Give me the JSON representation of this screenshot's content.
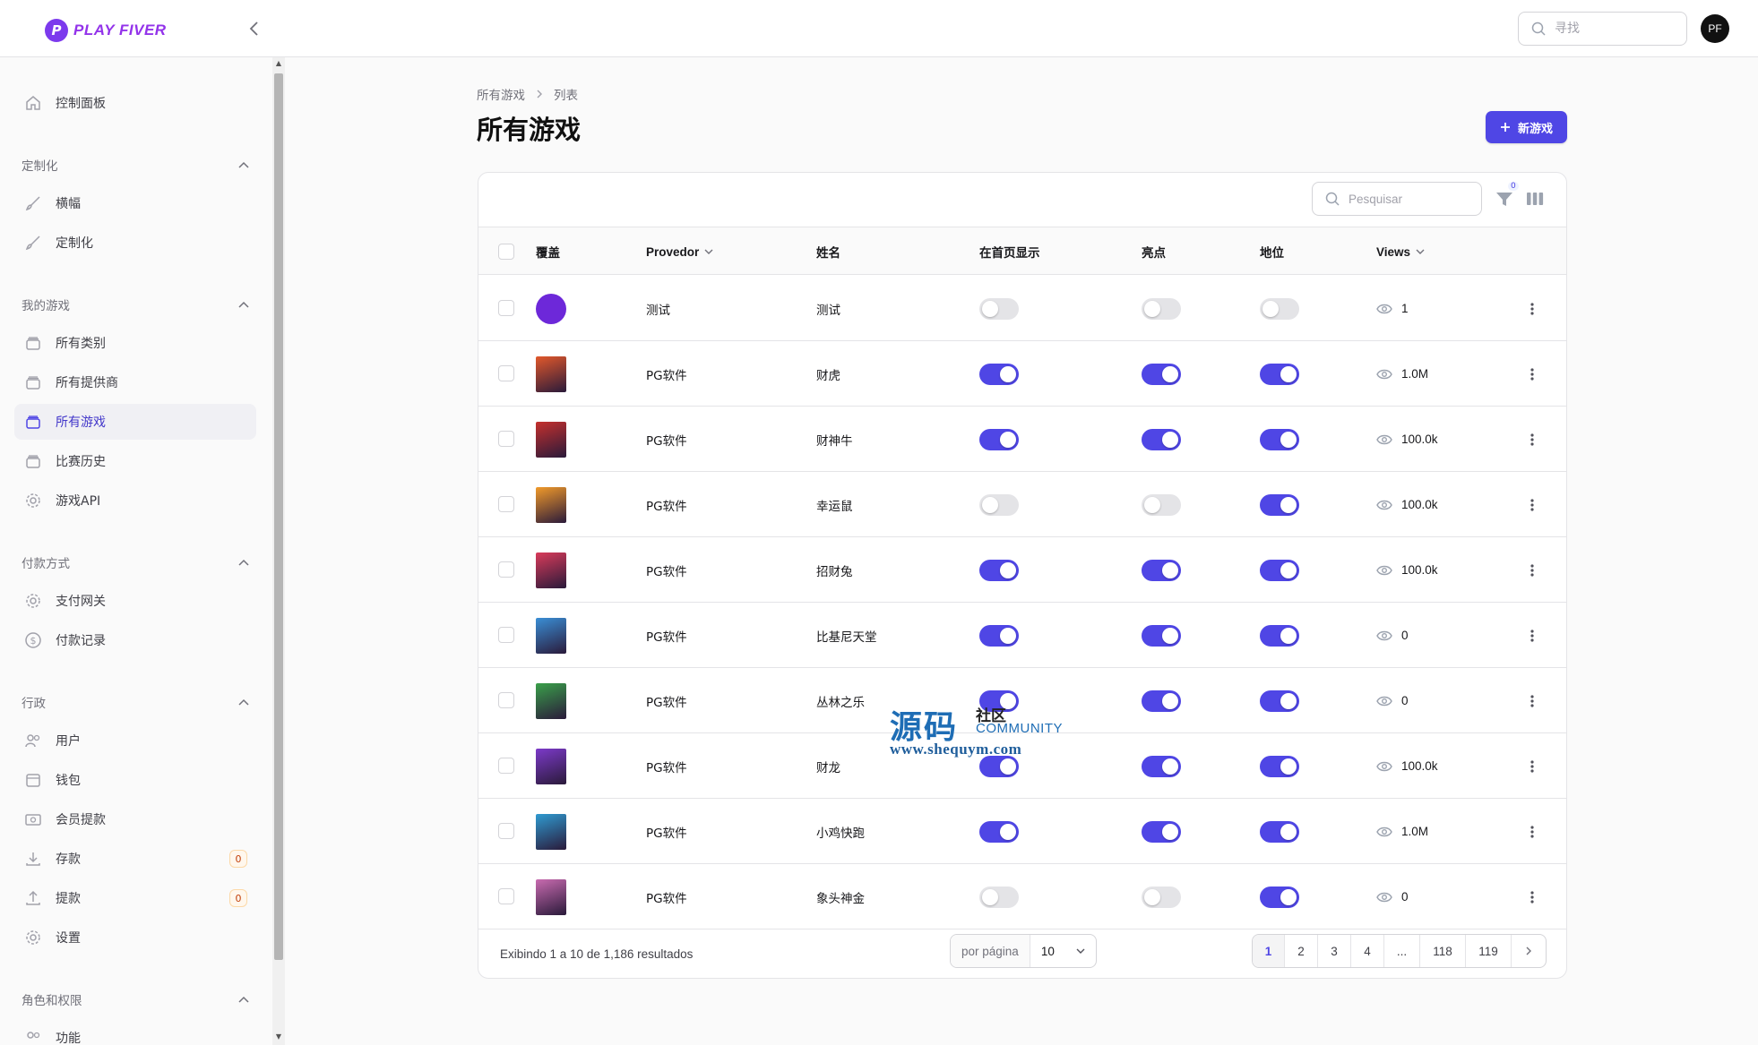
{
  "brand": {
    "name": "PLAY FIVER",
    "mark": "P"
  },
  "header": {
    "search_placeholder": "寻找",
    "avatar_initials": "PF"
  },
  "sidebar": {
    "dashboard": "控制面板",
    "groups": [
      {
        "title": "定制化",
        "items": [
          "横幅",
          "定制化"
        ]
      },
      {
        "title": "我的游戏",
        "items": [
          "所有类别",
          "所有提供商",
          "所有游戏",
          "比赛历史",
          "游戏API"
        ]
      },
      {
        "title": "付款方式",
        "items": [
          "支付网关",
          "付款记录"
        ]
      },
      {
        "title": "行政",
        "items": [
          "用户",
          "钱包",
          "会员提款",
          "存款",
          "提款",
          "设置"
        ]
      },
      {
        "title": "角色和权限",
        "items": [
          "功能"
        ]
      }
    ],
    "active_item": "所有游戏",
    "deposit_badge": "0",
    "withdraw_badge": "0"
  },
  "breadcrumb": [
    "所有游戏",
    "列表"
  ],
  "page_title": "所有游戏",
  "new_button": "新游戏",
  "table": {
    "search_placeholder": "Pesquisar",
    "filter_count": "0",
    "columns": [
      "覆盖",
      "Provedor",
      "姓名",
      "在首页显示",
      "亮点",
      "地位",
      "Views"
    ],
    "rows": [
      {
        "provider": "测试",
        "name": "测试",
        "home": false,
        "highlight": false,
        "status": false,
        "views": "1",
        "cover_color": "#6d28d9"
      },
      {
        "provider": "PG软件",
        "name": "财虎",
        "home": true,
        "highlight": true,
        "status": true,
        "views": "1.0M",
        "cover_color": "#e2582b"
      },
      {
        "provider": "PG软件",
        "name": "财神牛",
        "home": true,
        "highlight": true,
        "status": true,
        "views": "100.0k",
        "cover_color": "#c5302d"
      },
      {
        "provider": "PG软件",
        "name": "幸运鼠",
        "home": false,
        "highlight": false,
        "status": true,
        "views": "100.0k",
        "cover_color": "#f19a2a"
      },
      {
        "provider": "PG软件",
        "name": "招财兔",
        "home": true,
        "highlight": true,
        "status": true,
        "views": "100.0k",
        "cover_color": "#d93b5a"
      },
      {
        "provider": "PG软件",
        "name": "比基尼天堂",
        "home": true,
        "highlight": true,
        "status": true,
        "views": "0",
        "cover_color": "#3a8fd6"
      },
      {
        "provider": "PG软件",
        "name": "丛林之乐",
        "home": true,
        "highlight": true,
        "status": true,
        "views": "0",
        "cover_color": "#3aa04a"
      },
      {
        "provider": "PG软件",
        "name": "财龙",
        "home": true,
        "highlight": true,
        "status": true,
        "views": "100.0k",
        "cover_color": "#7c3ac9"
      },
      {
        "provider": "PG软件",
        "name": "小鸡快跑",
        "home": true,
        "highlight": true,
        "status": true,
        "views": "1.0M",
        "cover_color": "#2f9bd1"
      },
      {
        "provider": "PG软件",
        "name": "象头神金",
        "home": false,
        "highlight": false,
        "status": true,
        "views": "0",
        "cover_color": "#c96bb0"
      }
    ],
    "summary": "Exibindo 1 a 10 de 1,186 resultados",
    "per_page_label": "por página",
    "per_page_value": "10",
    "pages": [
      "1",
      "2",
      "3",
      "4",
      "...",
      "118",
      "119"
    ],
    "current_page": "1"
  },
  "watermark": {
    "main": "源码",
    "side": "社区",
    "community": "COMMUNITY",
    "url": "www.shequym.com"
  },
  "colors": {
    "accent": "#4f46e5",
    "toggle_off": "#e4e4e7",
    "brand": "#9333ea"
  }
}
